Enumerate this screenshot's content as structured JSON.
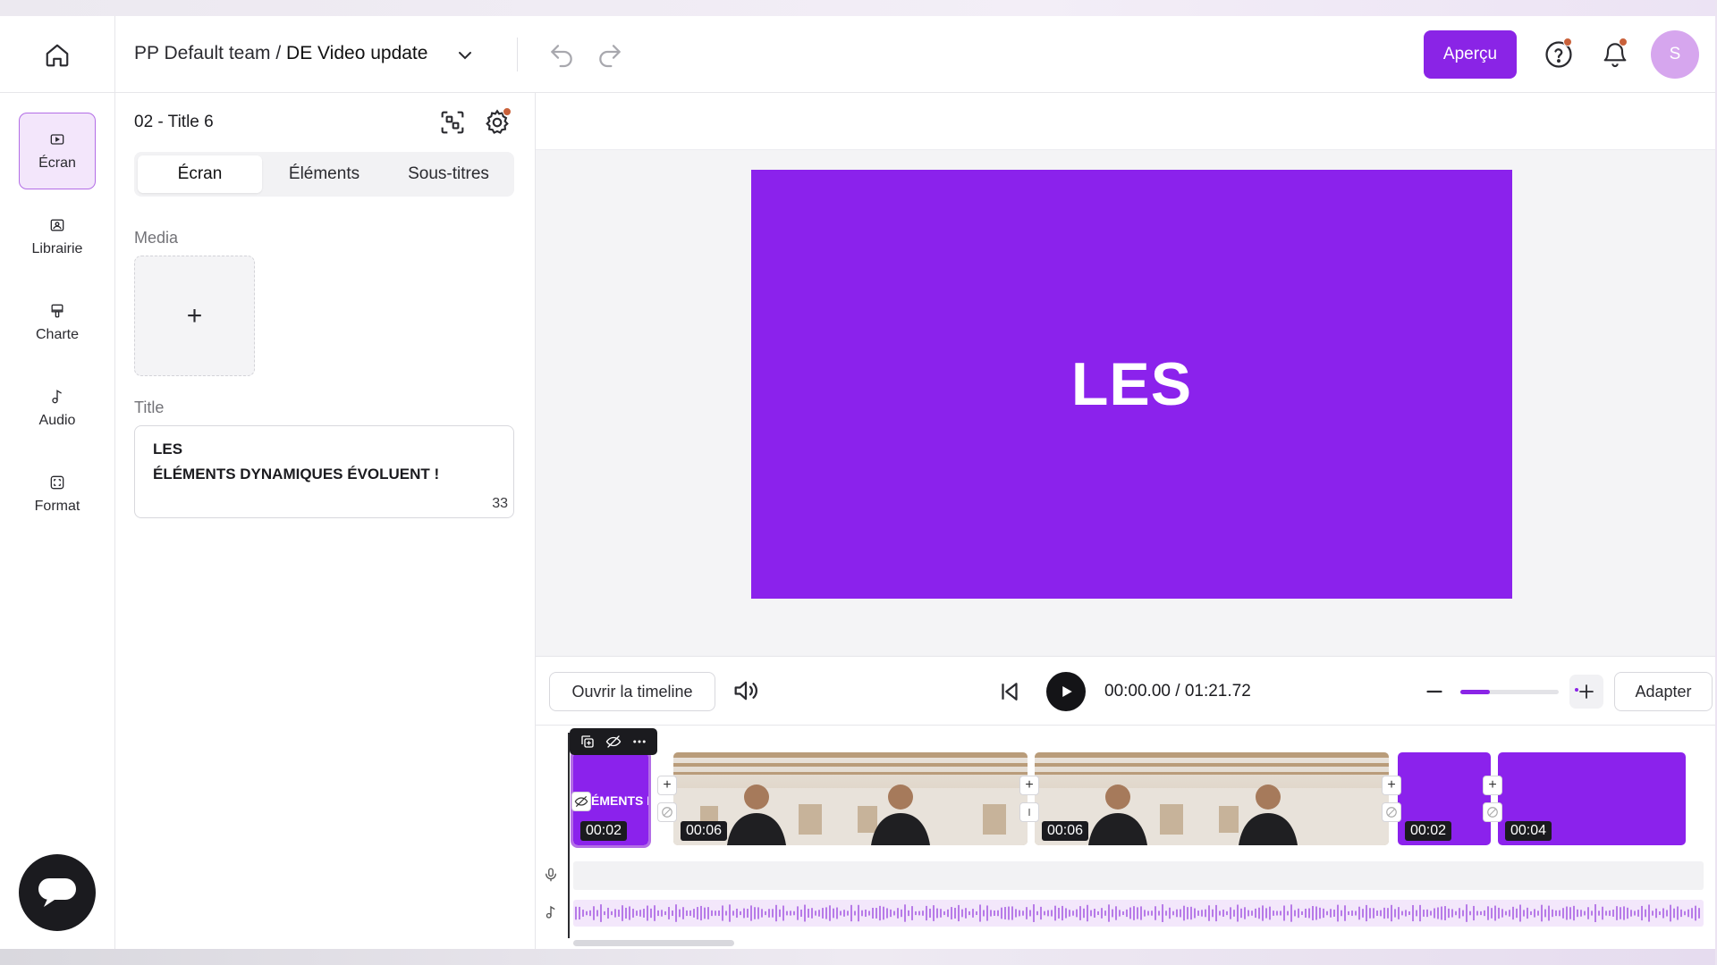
{
  "header": {
    "team": "PP Default team",
    "separator": " / ",
    "project_name": "DE Video update",
    "preview_button": "Aperçu",
    "avatar_initial": "S"
  },
  "left_rail": {
    "items": [
      {
        "label": "Écran",
        "icon": "screen-icon",
        "active": true
      },
      {
        "label": "Librairie",
        "icon": "library-icon",
        "active": false
      },
      {
        "label": "Charte",
        "icon": "brand-icon",
        "active": false
      },
      {
        "label": "Audio",
        "icon": "music-note-icon",
        "active": false
      },
      {
        "label": "Format",
        "icon": "format-icon",
        "active": false
      }
    ]
  },
  "panel": {
    "title": "02 - Title 6",
    "tabs": [
      {
        "label": "Écran",
        "active": true
      },
      {
        "label": "Éléments",
        "active": false
      },
      {
        "label": "Sous-titres",
        "active": false
      }
    ],
    "media_label": "Media",
    "media_add": "+",
    "title_label": "Title",
    "title_lines": [
      "LES",
      "ÉLÉMENTS DYNAMIQUES ÉVOLUENT !"
    ],
    "char_count": "33"
  },
  "preview": {
    "text": "LES",
    "background": "#8b22ec"
  },
  "playbar": {
    "open_timeline": "Ouvrir la timeline",
    "current_time": "00:00.00",
    "total_time": "01:21.72",
    "time_separator": " / ",
    "zoom_level": 0.3,
    "fit_button": "Adapter"
  },
  "timeline": {
    "clips": [
      {
        "type": "title",
        "duration": "00:02",
        "label": "ÉMENTS DY",
        "selected": true
      },
      {
        "type": "video",
        "duration": "00:06"
      },
      {
        "type": "video",
        "duration": "00:06"
      },
      {
        "type": "title",
        "duration": "00:02"
      },
      {
        "type": "title",
        "duration": "00:04"
      }
    ]
  },
  "colors": {
    "accent": "#8a24e6",
    "accent_light": "#f3e6fb",
    "badge": "#c9613a"
  }
}
